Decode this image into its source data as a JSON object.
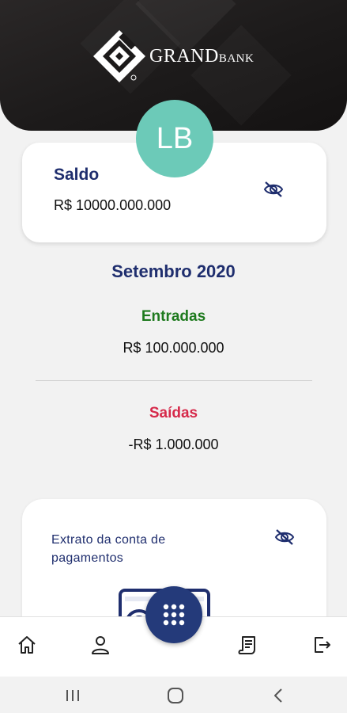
{
  "brand": {
    "logo_icon": "grandbank-logo",
    "name_big": "GRAND",
    "name_small": "BANK"
  },
  "user": {
    "initials": "LB"
  },
  "balance": {
    "title": "Saldo",
    "value": "R$ 10000.000.000",
    "toggle_icon": "eye-off-icon"
  },
  "summary": {
    "month": "Setembro 2020",
    "income_label": "Entradas",
    "income_value": "R$ 100.000.000",
    "expense_label": "Saídas",
    "expense_value": "-R$ 1.000.000"
  },
  "statement": {
    "label": "Extrato da conta de pagamentos",
    "toggle_icon": "eye-off-icon"
  },
  "nav": {
    "items": [
      {
        "icon": "home-icon"
      },
      {
        "icon": "user-icon"
      },
      {
        "icon": "keypad-icon"
      },
      {
        "icon": "receipt-icon"
      },
      {
        "icon": "logout-icon"
      }
    ]
  },
  "system_nav": [
    "recents-icon",
    "home-circle-icon",
    "back-icon"
  ],
  "colors": {
    "primary": "#1f2e6e",
    "income": "#1e7a1e",
    "expense": "#d6294a",
    "avatar": "#6ccab8",
    "fab": "#243a7a",
    "header": "#1c1a1a"
  }
}
